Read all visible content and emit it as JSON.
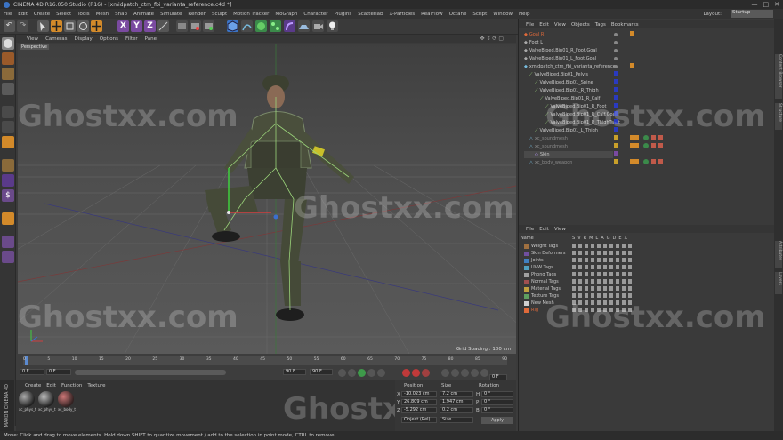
{
  "window": {
    "title": "CINEMA 4D R16.050 Studio (R16) - [xmidpatch_ctm_fbi_varianta_reference.c4d *]",
    "min": "—",
    "max": "□",
    "close": "✕"
  },
  "menu": [
    "File",
    "Edit",
    "Create",
    "Select",
    "Tools",
    "Mesh",
    "Snap",
    "Animate",
    "Simulate",
    "Render",
    "Sculpt",
    "Motion Tracker",
    "MoGraph",
    "Character",
    "Plugins",
    "Scatterlab",
    "X-Particles",
    "RealFlow",
    "Octane",
    "Script",
    "Window",
    "Help"
  ],
  "layout": {
    "label": "Layout:",
    "value": "Startup"
  },
  "toolbar_axes": {
    "x": "X",
    "y": "Y",
    "z": "Z"
  },
  "viewport": {
    "menu": [
      "View",
      "Cameras",
      "Display",
      "Options",
      "Filter",
      "Panel"
    ],
    "label": "Perspective",
    "grid_spacing": "Grid Spacing : 100 cm"
  },
  "watermark": "Ghostxx.com",
  "object_manager": {
    "menu": [
      "File",
      "Edit",
      "View",
      "Objects",
      "Tags",
      "Bookmarks"
    ],
    "rows": [
      {
        "name": "Goal R",
        "indent": 0,
        "color": "#e06a3a"
      },
      {
        "name": "Foot L",
        "indent": 0,
        "color": "#d0d0d0"
      },
      {
        "name": "ValveBiped.Bip01_R_Foot.Goal",
        "indent": 0,
        "color": "#d0d0d0"
      },
      {
        "name": "ValveBiped.Bip01_L_Foot.Goal",
        "indent": 0,
        "color": "#d0d0d0"
      },
      {
        "name": "xmidpatch_ctm_fbi_varianta_reference",
        "indent": 0,
        "color": "#d0d0d0"
      },
      {
        "name": "ValveBiped.Bip01_Pelvis",
        "indent": 1,
        "color": "#d0d0d0"
      },
      {
        "name": "ValveBiped.Bip01_Spine",
        "indent": 2,
        "color": "#d0d0d0"
      },
      {
        "name": "ValveBiped.Bip01_R_Thigh",
        "indent": 2,
        "color": "#d0d0d0"
      },
      {
        "name": "ValveBiped.Bip01_R_Calf",
        "indent": 3,
        "color": "#d0d0d0"
      },
      {
        "name": "ValveBiped.Bip01_R_Foot",
        "indent": 4,
        "color": "#d0d0d0"
      },
      {
        "name": "ValveBiped.Bip01_R_Calf.Goal",
        "indent": 4,
        "color": "#d0d0d0"
      },
      {
        "name": "ValveBiped.Bip01_R_ThighTwist",
        "indent": 4,
        "color": "#d0d0d0"
      },
      {
        "name": "ValveBiped.Bip01_L_Thigh",
        "indent": 2,
        "color": "#d0d0d0"
      },
      {
        "name": "xc_soundmesh",
        "indent": 1,
        "color": "#8a8a8a"
      },
      {
        "name": "xc_soundmesh",
        "indent": 1,
        "color": "#8a8a8a"
      },
      {
        "name": "Skin",
        "indent": 2,
        "color": "#d0d0d0"
      },
      {
        "name": "xc_body_weapon",
        "indent": 1,
        "color": "#8a8a8a"
      }
    ]
  },
  "attribute_manager": {
    "menu": [
      "File",
      "Edit",
      "View"
    ],
    "name_header": "Name",
    "col_headers": [
      "S",
      "V",
      "R",
      "M",
      "L",
      "A",
      "G",
      "D",
      "E",
      "X"
    ],
    "rows": [
      {
        "name": "Weight Tags",
        "color": "#a07040"
      },
      {
        "name": "Skin Deformers",
        "color": "#7050a0"
      },
      {
        "name": "Joints",
        "color": "#4080c0"
      },
      {
        "name": "UVW Tags",
        "color": "#50a0c0"
      },
      {
        "name": "Phong Tags",
        "color": "#a0a0a0"
      },
      {
        "name": "Normal Tags",
        "color": "#a05050"
      },
      {
        "name": "Material Tags",
        "color": "#c0a040"
      },
      {
        "name": "Texture Tags",
        "color": "#60a060"
      },
      {
        "name": "New Mesh",
        "color": "#d0d0d0"
      },
      {
        "name": "Rig",
        "color": "#e06a3a"
      }
    ]
  },
  "timeline": {
    "ticks": [
      "0",
      "5",
      "10",
      "15",
      "20",
      "25",
      "30",
      "35",
      "40",
      "45",
      "50",
      "55",
      "60",
      "65",
      "70",
      "75",
      "80",
      "85",
      "90"
    ],
    "start": "0 F",
    "current": "0 F",
    "end": "90 F",
    "end2": "90 F",
    "frame": "0 F"
  },
  "material_manager": {
    "menu": [
      "Create",
      "Edit",
      "Function",
      "Texture"
    ],
    "materials": [
      "xc_phys_t",
      "xc_phys_t",
      "xc_body_t"
    ]
  },
  "coordinates": {
    "headers": [
      "Position",
      "Size",
      "Rotation"
    ],
    "rows": [
      {
        "axis": "X",
        "pos": "-10.023 cm",
        "size": "7.2 cm",
        "rot_axis": "H",
        "rot": "0 °"
      },
      {
        "axis": "Y",
        "pos": "26.809 cm",
        "size": "1.947 cm",
        "rot_axis": "P",
        "rot": "0 °"
      },
      {
        "axis": "Z",
        "pos": "-5.292 cm",
        "size": "0.2 cm",
        "rot_axis": "B",
        "rot": "0 °"
      }
    ],
    "mode": "Object (Rel)",
    "size_mode": "Size",
    "apply": "Apply"
  },
  "status": "Move: Click and drag to move elements. Hold down SHIFT to quantize movement / add to the selection in point mode, CTRL to remove.",
  "logo": "MAXON CINEMA 4D",
  "side_tabs": [
    "Content Browser",
    "Structure",
    "Attributes",
    "Layers"
  ]
}
